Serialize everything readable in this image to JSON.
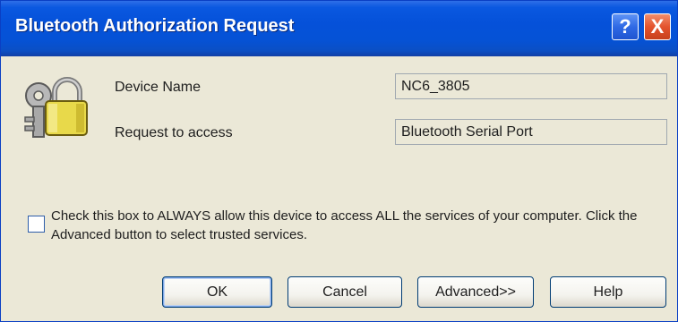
{
  "window": {
    "title": "Bluetooth Authorization Request",
    "help_label": "?",
    "close_label": "X"
  },
  "icon": {
    "name": "lock-key-icon"
  },
  "form": {
    "device_name_label": "Device Name",
    "device_name_value": "NC6_3805",
    "request_label": "Request to access",
    "request_value": "Bluetooth Serial Port"
  },
  "checkbox": {
    "checked": false,
    "text": "Check this box to ALWAYS allow this device to access ALL the services of your computer. Click the Advanced button to select trusted services."
  },
  "buttons": {
    "ok": "OK",
    "cancel": "Cancel",
    "advanced": "Advanced>>",
    "help": "Help"
  },
  "colors": {
    "title_bar": "#0552d6",
    "dialog_background": "#ebe8d7",
    "close_button": "#e4532d",
    "lock_body": "#e8d94a"
  }
}
